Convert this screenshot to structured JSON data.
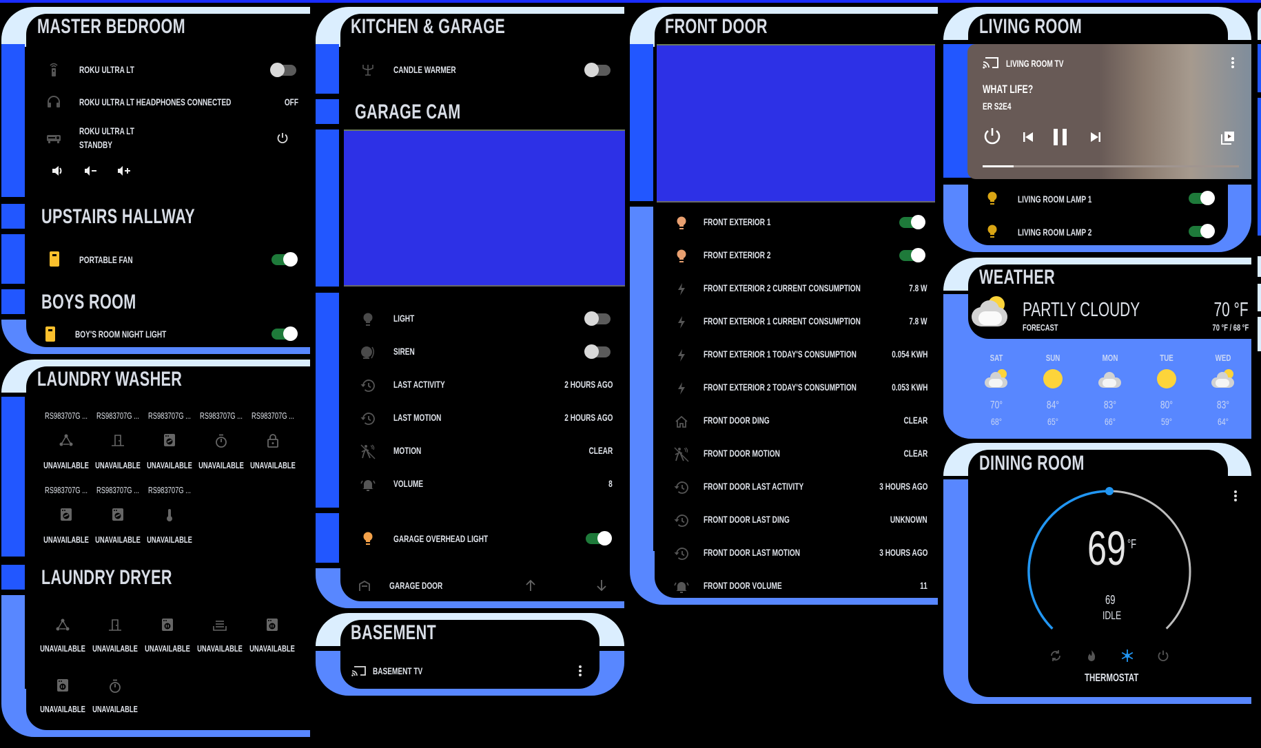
{
  "colors": {
    "accent_blue": "#2257ff",
    "light_blue": "#5887ff",
    "header_pale": "#dbeefe",
    "toggle_on": "#1e7a3a",
    "camera_placeholder": "#2d31e6",
    "thermostat_arc": "#2196f3",
    "bulb_yellow": "#f5c518",
    "bulb_peach": "#e9a070"
  },
  "master_bedroom": {
    "title": "MASTER BEDROOM",
    "rows": [
      {
        "icon": "remote-icon",
        "label": "ROKU ULTRA LT",
        "toggle": false
      },
      {
        "icon": "headphones-icon",
        "label": "ROKU ULTRA LT HEADPHONES CONNECTED",
        "value": "OFF"
      },
      {
        "icon": "receiver-icon",
        "label": "ROKU ULTRA LT",
        "sublabel": "STANDBY",
        "action": "power"
      }
    ],
    "volume_controls": [
      "mute",
      "volume-down",
      "volume-up"
    ]
  },
  "upstairs_hallway": {
    "title": "UPSTAIRS HALLWAY",
    "rows": [
      {
        "icon": "fan-plug-icon",
        "label": "PORTABLE FAN",
        "toggle": true
      }
    ]
  },
  "boys_room": {
    "title": "BOYS ROOM",
    "rows": [
      {
        "icon": "plug-icon",
        "label": "BOY'S ROOM NIGHT LIGHT",
        "toggle": true
      }
    ]
  },
  "laundry_washer": {
    "title": "LAUNDRY WASHER",
    "items": [
      {
        "name": "RS983707G ...",
        "icon": "network-icon",
        "state": "UNAVAILABLE"
      },
      {
        "name": "RS983707G ...",
        "icon": "door-icon",
        "state": "UNAVAILABLE"
      },
      {
        "name": "RS983707G ...",
        "icon": "washer-icon",
        "state": "UNAVAILABLE"
      },
      {
        "name": "RS983707G ...",
        "icon": "timer-icon",
        "state": "UNAVAILABLE"
      },
      {
        "name": "RS983707G ...",
        "icon": "lock-icon",
        "state": "UNAVAILABLE"
      },
      {
        "name": "RS983707G ...",
        "icon": "washer-icon",
        "state": "UNAVAILABLE"
      },
      {
        "name": "RS983707G ...",
        "icon": "washer-icon",
        "state": "UNAVAILABLE"
      },
      {
        "name": "RS983707G ...",
        "icon": "thermometer-icon",
        "state": "UNAVAILABLE"
      }
    ]
  },
  "laundry_dryer": {
    "title": "LAUNDRY DRYER",
    "items": [
      {
        "icon": "network-icon",
        "state": "UNAVAILABLE"
      },
      {
        "icon": "door-icon",
        "state": "UNAVAILABLE"
      },
      {
        "icon": "dryer-icon",
        "state": "UNAVAILABLE"
      },
      {
        "icon": "tray-icon",
        "state": "UNAVAILABLE"
      },
      {
        "icon": "dryer-icon",
        "state": "UNAVAILABLE"
      },
      {
        "icon": "dryer-icon",
        "state": "UNAVAILABLE"
      },
      {
        "icon": "timer-icon",
        "state": "UNAVAILABLE"
      }
    ]
  },
  "kitchen_garage": {
    "title": "KITCHEN & GARAGE",
    "candle": {
      "icon": "candelabra-icon",
      "label": "CANDLE WARMER",
      "toggle": false
    },
    "garage_cam_title": "GARAGE CAM",
    "cam_rows": [
      {
        "icon": "bulb-icon",
        "label": "LIGHT",
        "toggle": false
      },
      {
        "icon": "siren-icon",
        "label": "SIREN",
        "toggle": false
      },
      {
        "icon": "history-icon",
        "label": "LAST ACTIVITY",
        "value": "2 HOURS AGO"
      },
      {
        "icon": "history-icon",
        "label": "LAST MOTION",
        "value": "2 HOURS AGO"
      },
      {
        "icon": "motion-icon",
        "label": "MOTION",
        "value": "CLEAR"
      },
      {
        "icon": "bell-icon",
        "label": "VOLUME",
        "value": "8"
      }
    ],
    "overhead": {
      "icon": "bulb-icon",
      "label": "GARAGE OVERHEAD LIGHT",
      "toggle": true
    },
    "garage_door": {
      "icon": "garage-icon",
      "label": "GARAGE DOOR"
    }
  },
  "basement": {
    "title": "BASEMENT",
    "tv_label": "BASEMENT TV"
  },
  "front_door": {
    "title": "FRONT DOOR",
    "rows": [
      {
        "icon": "bulb-icon",
        "label": "FRONT EXTERIOR 1",
        "toggle": true
      },
      {
        "icon": "bulb-icon",
        "label": "FRONT EXTERIOR 2",
        "toggle": true
      },
      {
        "icon": "flash-icon",
        "label": "FRONT EXTERIOR 2 CURRENT CONSUMPTION",
        "value": "7.8 W"
      },
      {
        "icon": "flash-icon",
        "label": "FRONT EXTERIOR 1 CURRENT CONSUMPTION",
        "value": "7.8 W"
      },
      {
        "icon": "flash-icon",
        "label": "FRONT EXTERIOR 1 TODAY'S CONSUMPTION",
        "value": "0.054 KWH"
      },
      {
        "icon": "flash-icon",
        "label": "FRONT EXTERIOR 2 TODAY'S CONSUMPTION",
        "value": "0.053 KWH"
      },
      {
        "icon": "home-icon",
        "label": "FRONT DOOR DING",
        "value": "CLEAR"
      },
      {
        "icon": "motion-icon",
        "label": "FRONT DOOR MOTION",
        "value": "CLEAR"
      },
      {
        "icon": "history-icon",
        "label": "FRONT DOOR LAST ACTIVITY",
        "value": "3 HOURS AGO"
      },
      {
        "icon": "history-icon",
        "label": "FRONT DOOR LAST DING",
        "value": "UNKNOWN"
      },
      {
        "icon": "history-icon",
        "label": "FRONT DOOR LAST MOTION",
        "value": "3 HOURS AGO"
      },
      {
        "icon": "bell-icon",
        "label": "FRONT DOOR VOLUME",
        "value": "11"
      }
    ]
  },
  "living_room": {
    "title": "LIVING ROOM",
    "media": {
      "device": "LIVING ROOM TV",
      "title": "WHAT LIFE?",
      "subtitle": "ER S2E4",
      "progress": 0.12
    },
    "rows": [
      {
        "icon": "bulb-icon",
        "label": "LIVING ROOM LAMP 1",
        "toggle": true
      },
      {
        "icon": "bulb-icon",
        "label": "LIVING ROOM LAMP 2",
        "toggle": true
      }
    ]
  },
  "weather": {
    "title": "WEATHER",
    "condition": "PARTLY CLOUDY",
    "sub": "FORECAST",
    "temp": "70 °F",
    "hilo": "70 °F / 68 °F",
    "forecast": [
      {
        "day": "SAT",
        "icon": "partly-cloudy",
        "high": "70°",
        "low": "68°"
      },
      {
        "day": "SUN",
        "icon": "sunny",
        "high": "84°",
        "low": "65°"
      },
      {
        "day": "MON",
        "icon": "cloudy",
        "high": "83°",
        "low": "66°"
      },
      {
        "day": "TUE",
        "icon": "sunny",
        "high": "80°",
        "low": "59°"
      },
      {
        "day": "WED",
        "icon": "partly-cloudy",
        "high": "83°",
        "low": "64°"
      }
    ]
  },
  "dining_room": {
    "title": "DINING ROOM",
    "thermostat": {
      "target": "69",
      "unit": "°F",
      "current": "69",
      "action": "IDLE",
      "name": "THERMOSTAT",
      "modes": [
        "auto",
        "heat",
        "cool",
        "off"
      ],
      "active_mode": "cool",
      "setpoint_fraction": 0.5
    }
  }
}
